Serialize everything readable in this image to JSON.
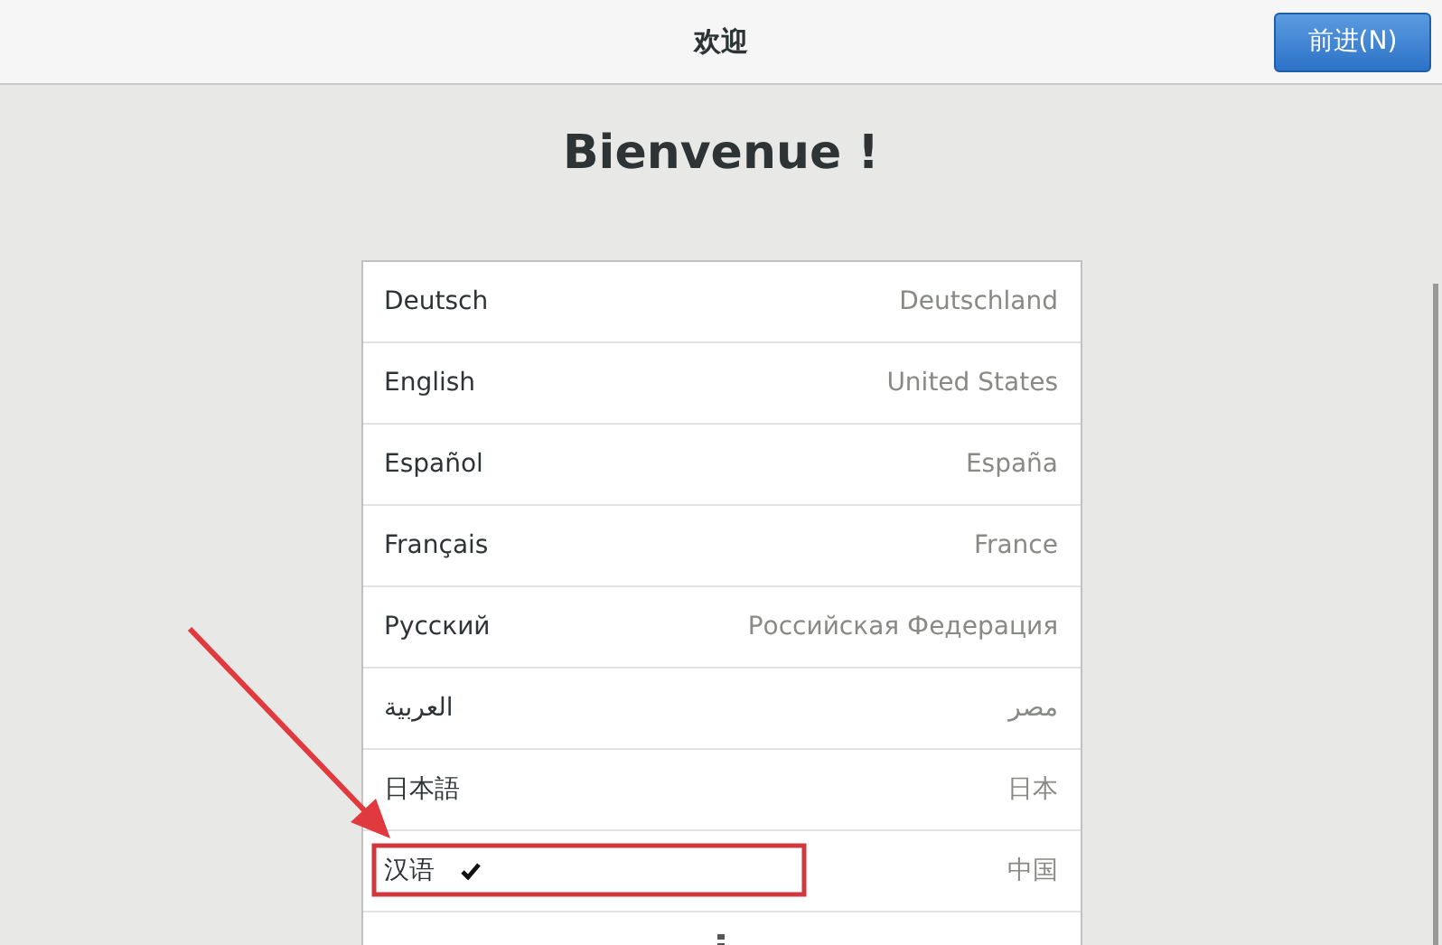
{
  "header": {
    "title": "欢迎",
    "next_button": "前进(N)"
  },
  "heading": "Bienvenue !",
  "languages": [
    {
      "name": "Deutsch",
      "region": "Deutschland",
      "selected": false
    },
    {
      "name": "English",
      "region": "United States",
      "selected": false
    },
    {
      "name": "Español",
      "region": "España",
      "selected": false
    },
    {
      "name": "Français",
      "region": "France",
      "selected": false
    },
    {
      "name": "Русский",
      "region": "Российская Федерация",
      "selected": false
    },
    {
      "name": "العربية",
      "region": "مصر",
      "selected": false
    },
    {
      "name": "日本語",
      "region": "日本",
      "selected": false
    },
    {
      "name": "汉语",
      "region": "中国",
      "selected": true
    }
  ]
}
